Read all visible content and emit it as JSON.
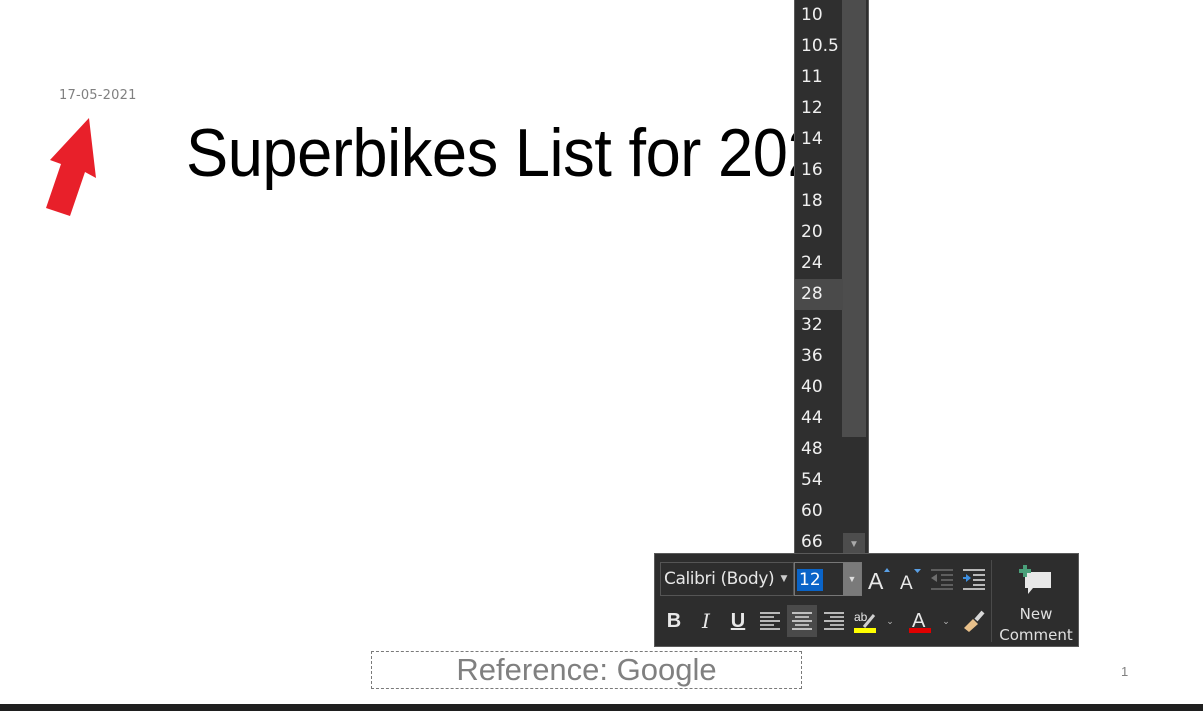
{
  "slide": {
    "date": "17-05-2021",
    "title": "Superbikes List for 2021",
    "footer": "Reference: Google",
    "page_number": "1"
  },
  "annotation": {
    "arrow_color": "#e8202a"
  },
  "font_size_dropdown": {
    "items": [
      "10",
      "10.5",
      "11",
      "12",
      "14",
      "16",
      "18",
      "20",
      "24",
      "28",
      "32",
      "36",
      "40",
      "44",
      "48",
      "54",
      "60",
      "66"
    ],
    "hovered": "28"
  },
  "mini_toolbar": {
    "font_name": "Calibri (Body)",
    "font_size": "12",
    "buttons": {
      "bold": "B",
      "italic": "I",
      "underline": "U",
      "grow_font": "A",
      "shrink_font": "A",
      "font_color": "A",
      "highlight_text": "ab"
    },
    "highlight_color": "#ffff00",
    "font_color_value": "#e00000",
    "new_comment": [
      "New",
      "Comment"
    ]
  }
}
